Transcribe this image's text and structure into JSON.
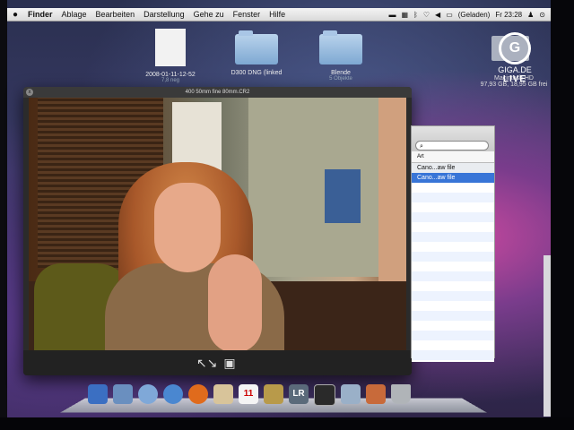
{
  "menubar": {
    "apple": "",
    "items": [
      "Finder",
      "Ablage",
      "Bearbeiten",
      "Darstellung",
      "Gehe zu",
      "Fenster",
      "Hilfe"
    ],
    "battery": "(Geladen)",
    "clock": "Fr 23:28"
  },
  "desktop": {
    "icons": [
      {
        "name": "2008-01-11-12-52",
        "sub": "7,8 neg"
      },
      {
        "name": "D300 DNG (linked",
        "sub": ""
      },
      {
        "name": "Blende",
        "sub": "5 Objekte"
      }
    ],
    "hdd": {
      "name": "Macintosh HD",
      "sub": "97,93 GB, 18,95 GB frei"
    }
  },
  "watermark": {
    "logo": "G",
    "site": "GIGA.DE",
    "live": "LIVE"
  },
  "quicklook": {
    "title": "400 50mm fine 80mm.CR2",
    "close": "x",
    "fullscreen_icon": "↖↘",
    "iphoto_icon": "▣"
  },
  "finder_list": {
    "search_placeholder": "",
    "header": "Art",
    "rows": [
      "Cano...aw file",
      "Cano...aw file"
    ]
  },
  "dock": {
    "items": [
      "finder-icon",
      "mail-icon",
      "itunes-icon",
      "safari-icon",
      "firefox-icon",
      "preview-icon",
      "ical-icon",
      "lightroom-icon",
      "monitor-icon",
      "photo-icon",
      "toolbox-icon",
      "trash-icon"
    ],
    "ical_day": "11",
    "lightroom_label": "LR"
  }
}
